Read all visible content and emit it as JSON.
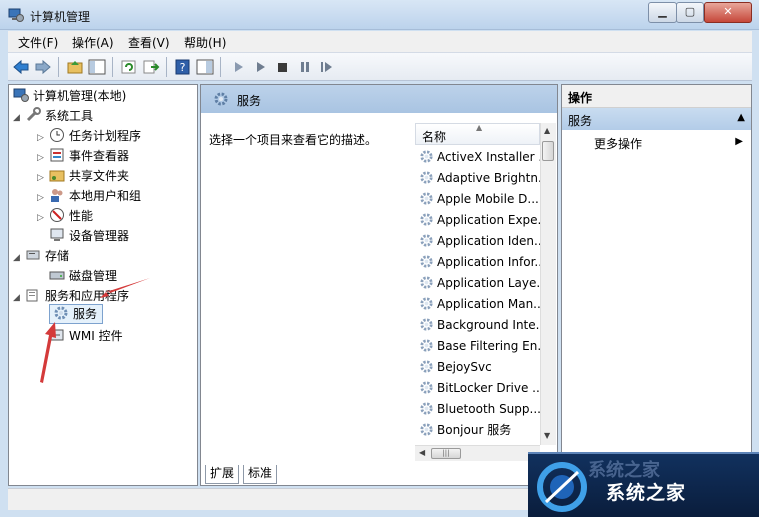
{
  "window": {
    "title": "计算机管理"
  },
  "menu": [
    "文件(F)",
    "操作(A)",
    "查看(V)",
    "帮助(H)"
  ],
  "tree": {
    "root": "计算机管理(本地)",
    "items": [
      {
        "label": "系统工具",
        "level": 1,
        "expanded": true,
        "icon": "tools-icon"
      },
      {
        "label": "任务计划程序",
        "level": 2,
        "icon": "clock-icon"
      },
      {
        "label": "事件查看器",
        "level": 2,
        "icon": "event-viewer-icon"
      },
      {
        "label": "共享文件夹",
        "level": 2,
        "icon": "shared-folder-icon"
      },
      {
        "label": "本地用户和组",
        "level": 2,
        "icon": "users-icon"
      },
      {
        "label": "性能",
        "level": 2,
        "icon": "performance-icon"
      },
      {
        "label": "设备管理器",
        "level": 2,
        "icon": "device-manager-icon"
      },
      {
        "label": "存储",
        "level": 1,
        "expanded": true,
        "icon": "storage-icon"
      },
      {
        "label": "磁盘管理",
        "level": 2,
        "icon": "disk-icon"
      },
      {
        "label": "服务和应用程序",
        "level": 1,
        "expanded": true,
        "icon": "services-apps-icon"
      },
      {
        "label": "服务",
        "level": 2,
        "icon": "gear-icon",
        "selected": true
      },
      {
        "label": "WMI 控件",
        "level": 2,
        "icon": "wmi-icon"
      }
    ]
  },
  "center": {
    "title": "服务",
    "description": "选择一个项目来查看它的描述。",
    "column": "名称",
    "services": [
      "ActiveX Installer ...",
      "Adaptive Brightn...",
      "Apple Mobile D...",
      "Application Expe...",
      "Application Iden...",
      "Application Infor...",
      "Application Laye...",
      "Application Man...",
      "Background Inte...",
      "Base Filtering En...",
      "BejoySvc",
      "BitLocker Drive ...",
      "Bluetooth Supp...",
      "Bonjour 服务"
    ],
    "tabs": [
      "扩展",
      "标准"
    ]
  },
  "actions": {
    "header": "操作",
    "section": "服务",
    "more": "更多操作"
  },
  "watermark": {
    "text": "系统之家",
    "faded": "系统之家"
  }
}
